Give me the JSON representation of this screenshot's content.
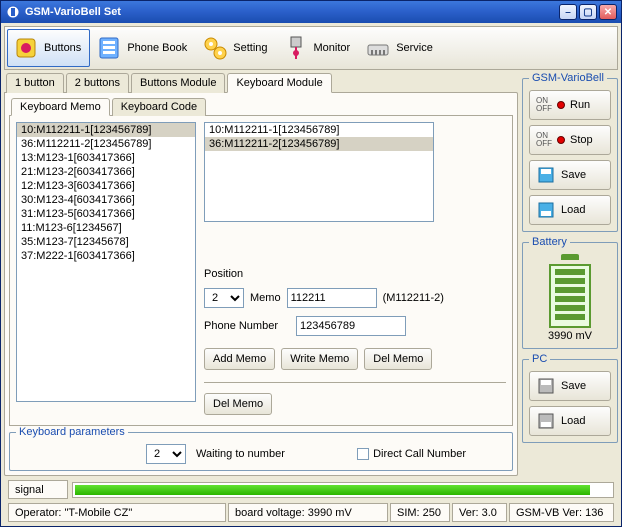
{
  "window": {
    "title": "GSM-VarioBell Set"
  },
  "toolbar": {
    "buttons": "Buttons",
    "phonebook": "Phone Book",
    "setting": "Setting",
    "monitor": "Monitor",
    "service": "Service"
  },
  "tabs": {
    "t1": "1 button",
    "t2": "2 buttons",
    "t3": "Buttons Module",
    "t4": "Keyboard Module"
  },
  "inner_tabs": {
    "memo": "Keyboard Memo",
    "code": "Keyboard Code"
  },
  "memo_list": [
    "10:M112211-1[123456789]",
    "36:M112211-2[123456789]",
    "13:M123-1[603417366]",
    "21:M123-2[603417366]",
    "12:M123-3[603417366]",
    "30:M123-4[603417366]",
    "31:M123-5[603417366]",
    "11:M123-6[1234567]",
    "35:M123-7[12345678]",
    "37:M222-1[603417366]"
  ],
  "right_list": [
    "10:M112211-1[123456789]",
    "36:M112211-2[123456789]"
  ],
  "form": {
    "position_label": "Position",
    "position_value": "2",
    "memo_label": "Memo",
    "memo_value": "112211",
    "memo_code": "(M112211-2)",
    "phone_label": "Phone Number",
    "phone_value": "123456789",
    "add": "Add Memo",
    "write": "Write Memo",
    "del": "Del Memo",
    "del2": "Del Memo"
  },
  "kb_params": {
    "legend": "Keyboard parameters",
    "wait_value": "2",
    "wait_label": "Waiting to number",
    "direct": "Direct Call Number"
  },
  "side": {
    "group1": "GSM-VarioBell",
    "run": "Run",
    "stop": "Stop",
    "save1": "Save",
    "load1": "Load",
    "group2": "Battery",
    "batt_text": "3990 mV",
    "group3": "PC",
    "save2": "Save",
    "load2": "Load",
    "on": "ON",
    "off": "OFF"
  },
  "status": {
    "signal": "signal"
  },
  "info": {
    "operator": "Operator: \"T-Mobile CZ\"",
    "voltage": "board voltage: 3990 mV",
    "sim": "SIM: 250",
    "ver": "Ver: 3.0",
    "gsm": "GSM-VB Ver: 136"
  }
}
